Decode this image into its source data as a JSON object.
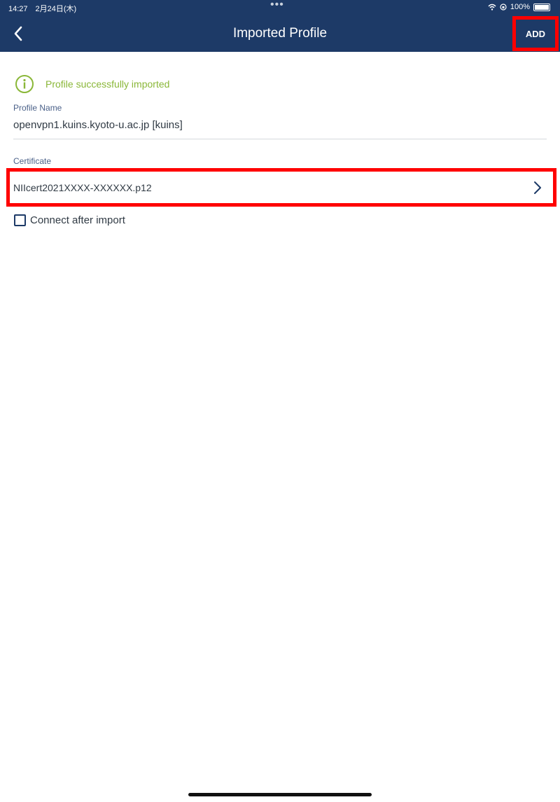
{
  "status_bar": {
    "time_date": "14:27　2月24日(木)",
    "dots": "•••",
    "battery": "100%"
  },
  "header": {
    "title": "Imported Profile",
    "add_label": "ADD"
  },
  "notice": {
    "success_text": "Profile successfully imported"
  },
  "profile": {
    "name_label": "Profile Name",
    "name_value": "openvpn1.kuins.kyoto-u.ac.jp [kuins]"
  },
  "certificate": {
    "label": "Certificate",
    "value": "NIIcert2021XXXX-XXXXXX.p12"
  },
  "options": {
    "connect_after_import_label": "Connect after import",
    "connect_after_import_checked": false
  },
  "colors": {
    "header_bg": "#1d3a67",
    "success_green": "#8ab738",
    "highlight_red": "#ff0000"
  }
}
